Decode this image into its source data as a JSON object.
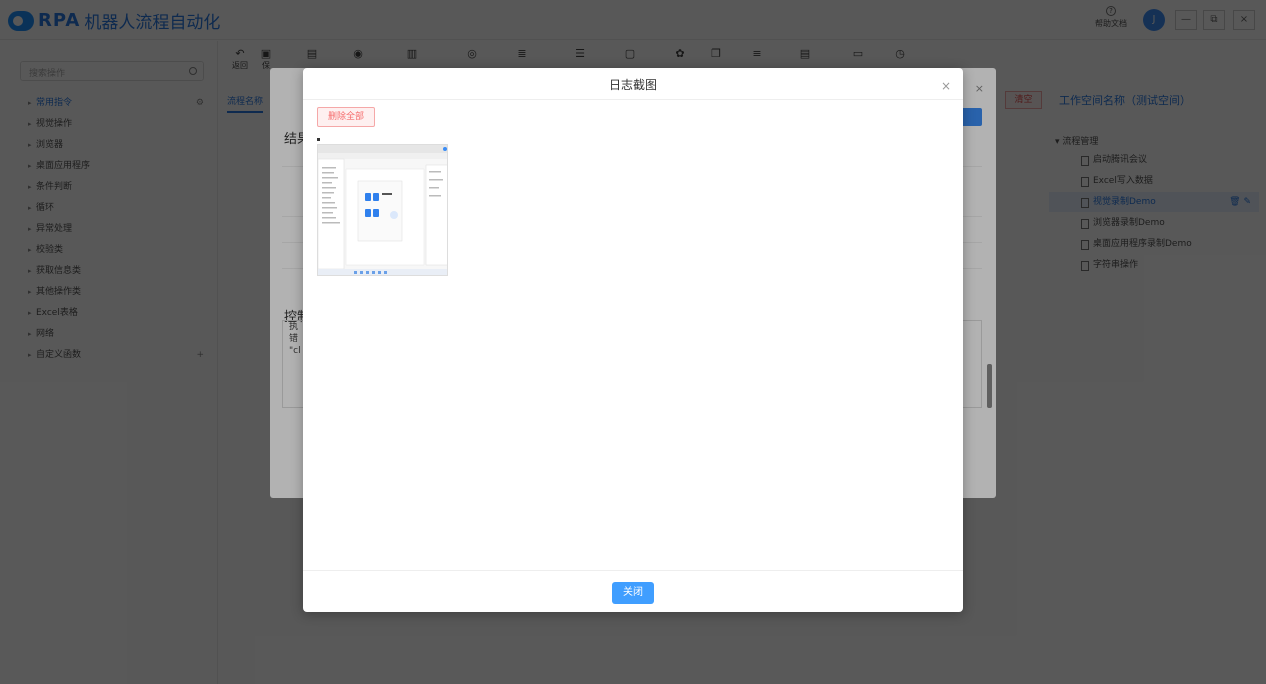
{
  "app": {
    "logo_text": "RPA",
    "title": "机器人流程自动化",
    "help_label": "帮助文档",
    "user_initial": "J",
    "window_buttons": [
      "—",
      "⧉",
      "×"
    ]
  },
  "sidebar": {
    "search_placeholder": "搜索操作",
    "items": [
      {
        "label": "常用指令"
      },
      {
        "label": "视觉操作"
      },
      {
        "label": "浏览器"
      },
      {
        "label": "桌面应用程序"
      },
      {
        "label": "条件判断"
      },
      {
        "label": "循环"
      },
      {
        "label": "异常处理"
      },
      {
        "label": "校验类"
      },
      {
        "label": "获取信息类"
      },
      {
        "label": "其他操作类"
      },
      {
        "label": "Excel表格"
      },
      {
        "label": "网络"
      },
      {
        "label": "自定义函数"
      }
    ],
    "add_mark": "+"
  },
  "toolbar": {
    "undo_label": "返回",
    "save_label": "保"
  },
  "main": {
    "tab_label": "流程名称",
    "result_label": "结果",
    "console_label": "控制",
    "console_lines": [
      "执",
      "错",
      "\"cl"
    ]
  },
  "right": {
    "clear_label": "清空",
    "workspace_title": "工作空间名称（测试空间）",
    "tree_root": "流程管理",
    "tree_items": [
      {
        "label": "启动腾讯会议"
      },
      {
        "label": "Excel写入数据"
      },
      {
        "label": "视觉录制Demo"
      },
      {
        "label": "浏览器录制Demo"
      },
      {
        "label": "桌面应用程序录制Demo"
      },
      {
        "label": "字符串操作"
      }
    ]
  },
  "modal": {
    "title": "日志截图",
    "close_symbol": "×",
    "delete_all_label": "删除全部",
    "close_button_label": "关闭"
  },
  "colors": {
    "accent": "#409eff",
    "danger": "#f56c6c",
    "brand": "#2b7be4"
  }
}
